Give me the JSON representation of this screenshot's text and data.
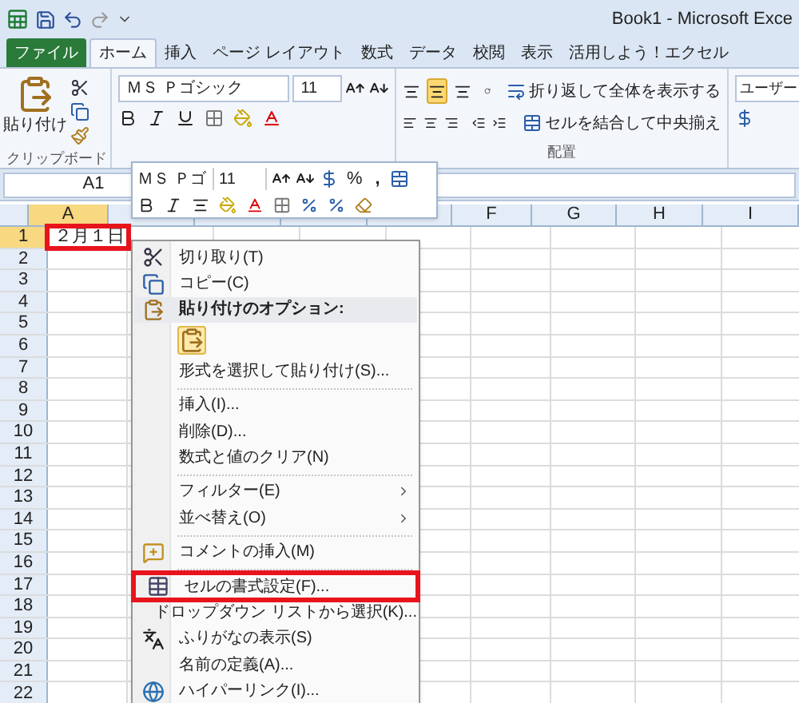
{
  "window": {
    "title": "Book1 - Microsoft Exce"
  },
  "tabs": [
    {
      "label": "ファイル",
      "kind": "file",
      "selected": false
    },
    {
      "label": "ホーム",
      "kind": "tab",
      "selected": true
    },
    {
      "label": "挿入",
      "kind": "tab",
      "selected": false
    },
    {
      "label": "ページ レイアウト",
      "kind": "tab",
      "selected": false
    },
    {
      "label": "数式",
      "kind": "tab",
      "selected": false
    },
    {
      "label": "データ",
      "kind": "tab",
      "selected": false
    },
    {
      "label": "校閲",
      "kind": "tab",
      "selected": false
    },
    {
      "label": "表示",
      "kind": "tab",
      "selected": false
    },
    {
      "label": "活用しよう！エクセル",
      "kind": "tab",
      "selected": false
    }
  ],
  "clipboard": {
    "paste_label": "貼り付け",
    "group_label": "クリップボード"
  },
  "font": {
    "name": "ＭＳ Ｐゴシック",
    "size": "11"
  },
  "alignment": {
    "vertical": [
      {
        "selected": false
      },
      {
        "selected": true
      },
      {
        "selected": false
      }
    ],
    "wrap_label": "折り返して全体を表示する",
    "merge_label": "セルを結合して中央揃え",
    "group_label": "配置"
  },
  "number": {
    "format": "ユーザー"
  },
  "formula_bar": {
    "name_box": "A1"
  },
  "columns": [
    "A",
    "F",
    "G",
    "H",
    "I"
  ],
  "rows": [
    "1",
    "2",
    "3",
    "4",
    "5",
    "6",
    "7",
    "8",
    "9",
    "10",
    "11",
    "12",
    "13",
    "14",
    "15",
    "16",
    "17",
    "18",
    "19",
    "20",
    "21",
    "22"
  ],
  "cell_a1": {
    "value": "２月１日",
    "highlighted": true
  },
  "mini_toolbar": {
    "font": "ＭＳ Ｐゴ",
    "size": "11",
    "percent": "%",
    "comma": ","
  },
  "context_menu": [
    {
      "kind": "item",
      "label": "切り取り(T)",
      "submenu": false,
      "highlighted": false
    },
    {
      "kind": "item",
      "label": "コピー(C)",
      "submenu": false,
      "highlighted": false
    },
    {
      "kind": "header",
      "label": "貼り付けのオプション:",
      "submenu": false,
      "highlighted": false
    },
    {
      "kind": "paste_icons"
    },
    {
      "kind": "item",
      "label": "形式を選択して貼り付け(S)...",
      "submenu": false,
      "highlighted": false
    },
    {
      "kind": "separator"
    },
    {
      "kind": "item",
      "label": "挿入(I)...",
      "submenu": false,
      "highlighted": false
    },
    {
      "kind": "item",
      "label": "削除(D)...",
      "submenu": false,
      "highlighted": false
    },
    {
      "kind": "item",
      "label": "数式と値のクリア(N)",
      "submenu": false,
      "highlighted": false
    },
    {
      "kind": "separator"
    },
    {
      "kind": "item",
      "label": "フィルター(E)",
      "submenu": true,
      "highlighted": false
    },
    {
      "kind": "item",
      "label": "並べ替え(O)",
      "submenu": true,
      "highlighted": false
    },
    {
      "kind": "separator"
    },
    {
      "kind": "item",
      "label": "コメントの挿入(M)",
      "submenu": false,
      "highlighted": false
    },
    {
      "kind": "separator"
    },
    {
      "kind": "item",
      "label": "セルの書式設定(F)...",
      "submenu": false,
      "highlighted": true
    },
    {
      "kind": "item",
      "label": "ドロップダウン リストから選択(K)...",
      "submenu": false,
      "highlighted": false
    },
    {
      "kind": "item",
      "label": "ふりがなの表示(S)",
      "submenu": false,
      "highlighted": false
    },
    {
      "kind": "item",
      "label": "名前の定義(A)...",
      "submenu": false,
      "highlighted": false
    },
    {
      "kind": "item",
      "label": "ハイパーリンク(I)...",
      "submenu": false,
      "highlighted": false
    }
  ]
}
